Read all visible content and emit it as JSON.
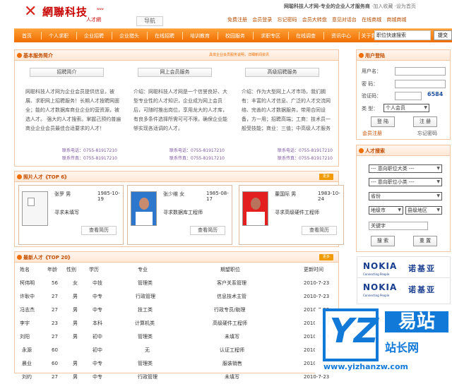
{
  "header": {
    "logo_text": "網聯科技",
    "logo_sub": "人才網",
    "logo_url": "www",
    "tag": "导航",
    "slogan": "网聪科技人才网-专业的企业人才服务商",
    "slogan_links": "·加入收藏 ·设为首页",
    "quick_links": [
      "免费注册",
      "会员登录",
      "忘记密码",
      "会员大转盘",
      "意见对话台",
      "在线商城",
      "商城商城"
    ]
  },
  "nav": {
    "items": [
      "首页",
      "个人求职",
      "企业招聘",
      "企业猎头",
      "在线招聘",
      "培训教育",
      "校园服务",
      "求职专区",
      "在线调查",
      "资讯中心",
      "关于我们"
    ],
    "search_placeholder": "职位快速搜索",
    "search_button": "提交"
  },
  "intro": {
    "title": "基本服务简介",
    "headline": "具体企业会员服务说明，详细新闻资讯",
    "buttons": [
      "招聘简介",
      "网上会员服务",
      "高级招聘服务"
    ],
    "columns": [
      "网聪科技人才网为企业会员提供信息，被展、求职网上招聘服务！长期人才按聘网面全；能的人才数据库商业企业的营资源，被选人才。 强大的人才搜索。掌握己预约普遍商业企业会员最佳合适要求的人才！",
      "介绍：网聪科技人才网是一个信誉良好、大型专业性的人才知识，企业成为网上会员后，可随时推出岗位，享用龙大的人才库，有良多条件选择所需可可不限，确保企业能够实现各适调的人才。",
      "介绍：作为大型网上人才市场，我们拥有：丰富的人才信息、广泛的人才交流网络、完善的人才数据服务，带用合同设备，方一用；招聘高端；工商：技术员一般受技能；商业：三值；中高级人才服务"
    ],
    "contacts": [
      [
        "联系电话：0755-81917210",
        "联系传真：0755-81917210"
      ],
      [
        "联系电话：0755-81917210",
        "联系传真：0755-81917210"
      ],
      [
        "联系电话：0755-81917210",
        "联系传真：0755-81917210"
      ]
    ]
  },
  "featured": {
    "title": "照片人才《TOP 6》",
    "more": "更多",
    "cards": [
      {
        "name": "张罗  男",
        "date": "1985-10-19",
        "job": "寻求未填写",
        "button": "查看简历"
      },
      {
        "name": "张少维  女",
        "date": "1985-08-17",
        "job": "寻求数据库工程师",
        "button": "查看简历"
      },
      {
        "name": "董国际  男",
        "date": "1983-10-24",
        "job": "寻求高级硬件工程师",
        "button": "查看简历"
      }
    ]
  },
  "latest": {
    "title": "最新人才《TOP 20》",
    "more": "更多",
    "headers": [
      "姓名",
      "年龄",
      "性别",
      "学历",
      "专业",
      "期望职位",
      "更新时间"
    ],
    "rows": [
      [
        "柯伟明",
        "56",
        "女",
        "中技",
        "管理类",
        "客户关系管理",
        "2010-7-23"
      ],
      [
        "许耿中",
        "27",
        "男",
        "中专",
        "行政管理",
        "信息技术主管",
        "2010-7-23"
      ],
      [
        "冯志杰",
        "27",
        "男",
        "中专",
        "技工类",
        "行政专员/助理",
        "2010-7-23"
      ],
      [
        "李宇",
        "23",
        "男",
        "本科",
        "计算机类",
        "高级硬件工程师",
        "2010-7-23"
      ],
      [
        "刘阳",
        "27",
        "男",
        "初中",
        "管理类",
        "未填写",
        "2010-7-23"
      ],
      [
        "永源",
        "60",
        "",
        "初中",
        "无",
        "认证工程师",
        "2010-7-23"
      ],
      [
        "晨业",
        "60",
        "男",
        "中专",
        "管理类",
        "服装销售",
        "2010-7-23"
      ],
      [
        "刘约",
        "27",
        "男",
        "中专",
        "行政管理",
        "未填写",
        "2010-7-23"
      ]
    ]
  },
  "login": {
    "title": "用户登陆",
    "labels": [
      "用户名：",
      "密  码：",
      "验证码：",
      "类  型："
    ],
    "captcha": "6584",
    "type_value": "个人会员",
    "buttons": [
      "登 陆",
      "注 册"
    ],
    "links": [
      "会员注册",
      "忘记密码"
    ]
  },
  "search": {
    "title": "人才搜索",
    "select1": "--- 意向职位大类 ---",
    "select2": "--- 意向职位小类 ---",
    "select3": "省份",
    "select4": "地级市",
    "select5": "县级地区",
    "keyword": "关键字",
    "buttons": [
      "搜 索",
      "重 置"
    ]
  },
  "ads": [
    {
      "brand": "NOKIA",
      "sub": "Connecting People",
      "cn": "诺基亚"
    },
    {
      "brand": "NOKIA",
      "sub": "Connecting People",
      "cn": "诺基亚"
    }
  ],
  "watermark": {
    "logo": "YZ",
    "cn_top": "易站",
    "cn_bottom": "站长网",
    "url": "www.yizhanzw.com"
  },
  "colors": {
    "accent": "#f06d00",
    "brand": "#c80000",
    "watermark": "#1179d8"
  }
}
